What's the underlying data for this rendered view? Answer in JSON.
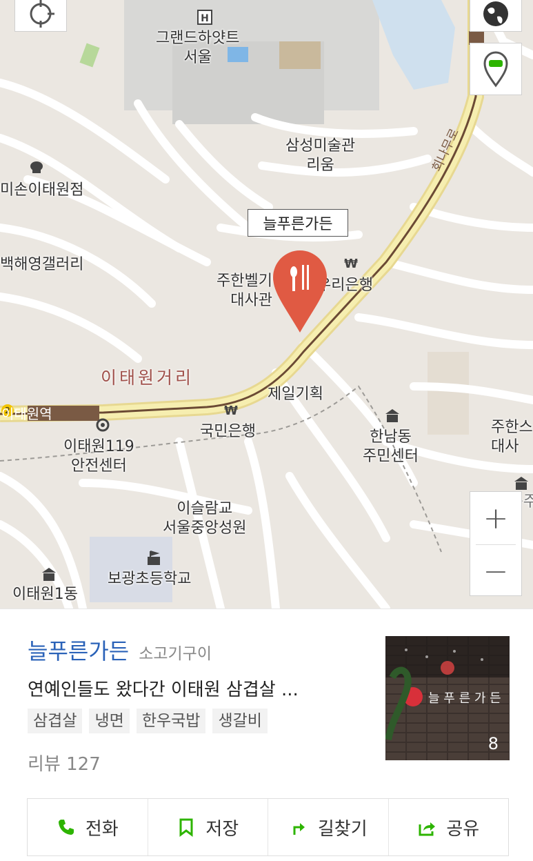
{
  "map": {
    "callout": "늘푸른가든",
    "district": "이태원거리",
    "road_label": "회나무로",
    "station": "이태원역",
    "station_number": "2",
    "labels": {
      "hyatt": "그랜드하얏트\n서울",
      "leeum": "삼성미술관\n리움",
      "leesun": "미손이태원점",
      "baekhae": "백해영갤러리",
      "embassy": "주한벨기에\n대사관",
      "woori": "우리은행",
      "jeil": "제일기획",
      "kookmin": "국민은행",
      "itaewon119": "이태원119\n안전센터",
      "hannam_center": "한남동\n주민센터",
      "mosque": "이슬람교\n서울중앙성원",
      "bogwang": "보광초등학교",
      "itaewon1dong": "이태원1동",
      "embassy_right": "주한스\n대사",
      "hannam_right": "한남동주"
    },
    "controls": {
      "zoom_in": "+",
      "zoom_out": "−"
    }
  },
  "panel": {
    "name": "늘푸른가든",
    "category": "소고기구이",
    "description": "연예인들도 왔다간 이태원 삼겹살 ...",
    "tags": [
      "삼겹살",
      "냉면",
      "한우국밥",
      "생갈비"
    ],
    "review": "리뷰 127",
    "thumbnail_count": "8",
    "thumbnail_sign": "늘 푸 른 가 든",
    "actions": [
      {
        "label": "전화",
        "icon": "phone-icon"
      },
      {
        "label": "저장",
        "icon": "bookmark-icon"
      },
      {
        "label": "길찾기",
        "icon": "directions-icon"
      },
      {
        "label": "공유",
        "icon": "share-icon"
      }
    ]
  },
  "colors": {
    "link_blue": "#2a62b8",
    "pin_red": "#e05a43",
    "action_green": "#2db400",
    "road_yellow": "#f6eeb0",
    "road_brown": "#6b4a34",
    "district_red": "#a0504a"
  }
}
